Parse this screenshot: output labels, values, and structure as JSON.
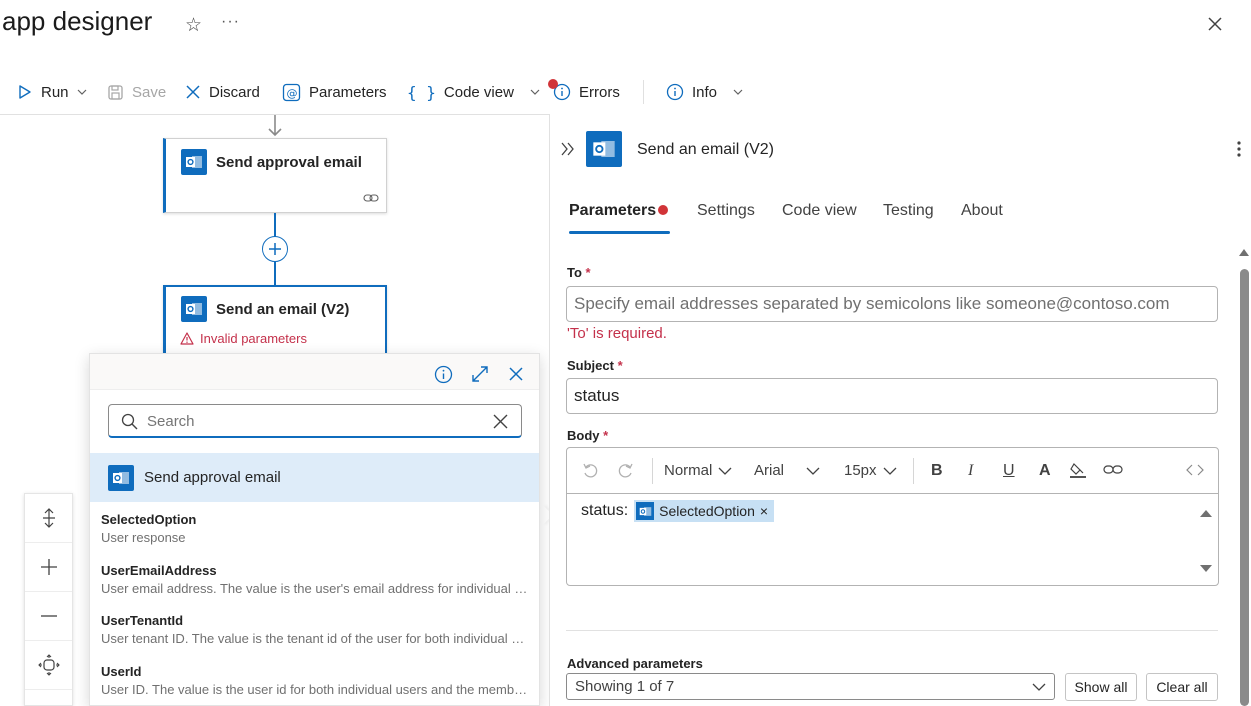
{
  "header": {
    "title": "app designer",
    "more": "···"
  },
  "toolbar": {
    "run": "Run",
    "save": "Save",
    "discard": "Discard",
    "parameters": "Parameters",
    "code_view": "Code view",
    "errors": "Errors",
    "info": "Info"
  },
  "canvas": {
    "card1": {
      "title": "Send approval email"
    },
    "card2": {
      "title": "Send an email (V2)",
      "error": "Invalid parameters"
    }
  },
  "popup": {
    "search_placeholder": "Search",
    "group_label": "Send approval email",
    "tokens": [
      {
        "name": "SelectedOption",
        "desc": "User response"
      },
      {
        "name": "UserEmailAddress",
        "desc": "User email address. The value is the user's email address for individual users and the member's email address for group members."
      },
      {
        "name": "UserTenantId",
        "desc": "User tenant ID. The value is the tenant id of the user for both individual users and group members."
      },
      {
        "name": "UserId",
        "desc": "User ID. The value is the user id for both individual users and the members of groups."
      }
    ]
  },
  "panel": {
    "title": "Send an email (V2)",
    "tabs": [
      "Parameters",
      "Settings",
      "Code view",
      "Testing",
      "About"
    ],
    "to": {
      "label": "To",
      "required": "*",
      "placeholder": "Specify email addresses separated by semicolons like someone@contoso.com",
      "error": "'To' is required."
    },
    "subject": {
      "label": "Subject",
      "required": "*",
      "value": "status"
    },
    "body": {
      "label": "Body",
      "required": "*",
      "format": "Normal",
      "font": "Arial",
      "size": "15px",
      "text": "status:",
      "token": "SelectedOption",
      "token_remove": "×"
    },
    "advanced": {
      "label": "Advanced parameters",
      "select": "Showing 1 of 7",
      "show_all": "Show all",
      "clear_all": "Clear all"
    }
  },
  "colors": {
    "accent": "#0f6cbd",
    "error": "#c4314b",
    "error_dot": "#d13438",
    "token_bg": "#c7e0f4"
  }
}
